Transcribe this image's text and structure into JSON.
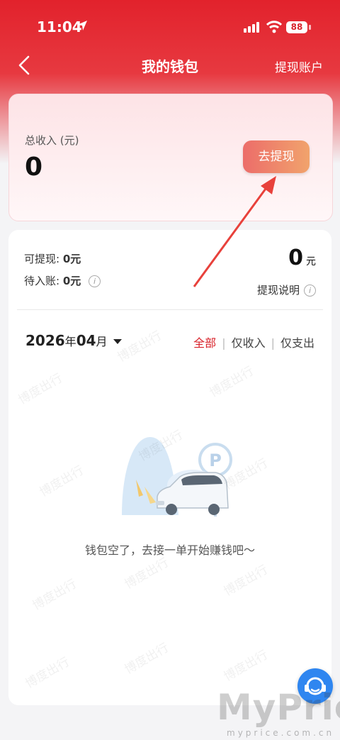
{
  "status_bar": {
    "time": "11:04",
    "battery": "88"
  },
  "nav": {
    "title": "我的钱包",
    "right_action": "提现账户"
  },
  "summary": {
    "total_label": "总收入 (元)",
    "total_value": "0",
    "withdraw_button": "去提现"
  },
  "balances": {
    "withdrawable_label": "可提现:",
    "withdrawable_value": "0元",
    "pending_label": "待入账:",
    "pending_value": "0元",
    "amount": "0",
    "amount_unit": "元",
    "explain": "提现说明"
  },
  "filter": {
    "year": "2026",
    "year_unit": "年",
    "month": "04",
    "month_unit": "月",
    "tabs": [
      "全部",
      "仅收入",
      "仅支出"
    ],
    "active_tab": "全部"
  },
  "empty_state": {
    "message": "钱包空了，去接一单开始赚钱吧～"
  },
  "watermark": "博度出行",
  "brand": {
    "name": "MyPrice",
    "url": "myprice.com.cn"
  },
  "colors": {
    "accent": "#d8232b",
    "button_start": "#ec6d6a",
    "button_end": "#f1a36c",
    "fab": "#2f86f0"
  }
}
